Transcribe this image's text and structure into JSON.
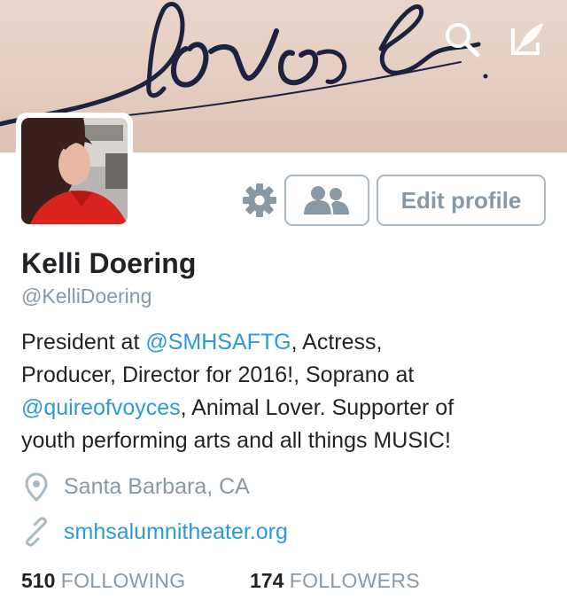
{
  "header": {
    "background_color": "#e4cdc0",
    "art_text_color": "#1c2340",
    "icons": [
      "search-icon",
      "compose-icon"
    ]
  },
  "profile": {
    "name": "Kelli Doering",
    "handle": "@KelliDoering",
    "bio": {
      "line1_prefix": "President at ",
      "line1_mention": "@SMHSAFTG",
      "line1_suffix": ", Actress,",
      "line2": "Producer, Director for 2016!, Soprano at",
      "line3_mention": "@quireofvoyces",
      "line3_suffix": ", Animal Lover. Supporter of",
      "line4": "youth performing arts and all things MUSIC!"
    },
    "location": "Santa Barbara, CA",
    "website": "smhsalumnitheater.org"
  },
  "actions": {
    "settings_icon": "gear-icon",
    "follow_icon": "people-icon",
    "edit_label": "Edit profile"
  },
  "stats": {
    "following_count": "510",
    "following_label": "FOLLOWING",
    "followers_count": "174",
    "followers_label": "FOLLOWERS"
  },
  "colors": {
    "link": "#2a9bd8",
    "secondary_text": "#8899a6",
    "primary_text": "#1f2326"
  }
}
